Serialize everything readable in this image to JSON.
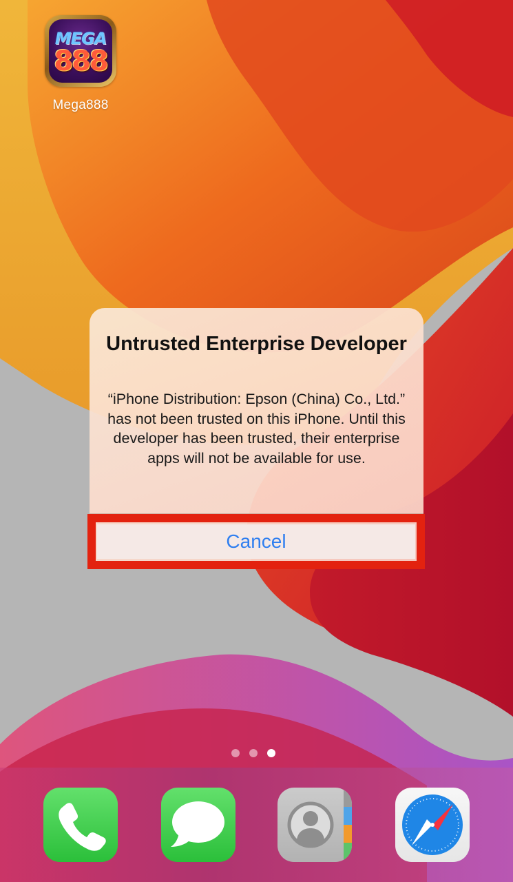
{
  "home": {
    "apps": [
      {
        "label": "Mega888",
        "icon": "mega888-app-icon",
        "icon_word": "MEGA",
        "icon_number": "888"
      }
    ],
    "page_dots": {
      "count": 3,
      "active_index": 2
    }
  },
  "alert": {
    "title": "Untrusted Enterprise Developer",
    "message": "“iPhone Distribution: Epson (China) Co., Ltd.” has not been trusted on this iPhone. Until this developer has been trusted, their enterprise apps will not be available for use.",
    "cancel_label": "Cancel",
    "button_color": "#2f7ff0",
    "highlight_color": "#e3220f"
  },
  "dock": {
    "apps": [
      {
        "name": "phone",
        "icon": "phone-icon"
      },
      {
        "name": "messages",
        "icon": "messages-icon"
      },
      {
        "name": "contacts",
        "icon": "contacts-icon"
      },
      {
        "name": "safari",
        "icon": "safari-compass-icon"
      }
    ]
  }
}
